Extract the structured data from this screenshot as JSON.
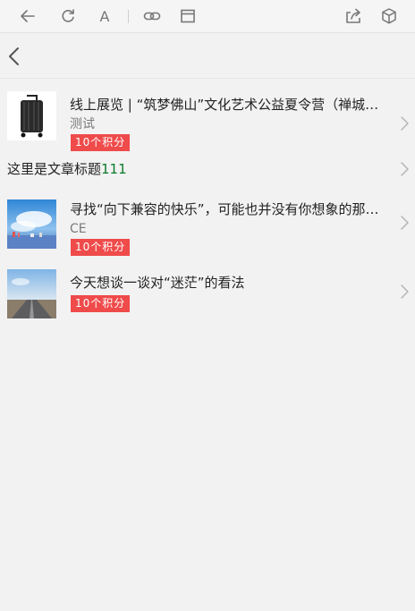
{
  "toolbar": {
    "icons": [
      "back-arrow-icon",
      "refresh-icon",
      "font-icon",
      "link-icon",
      "window-icon",
      "share-icon",
      "cube-icon"
    ],
    "font_glyph": "A"
  },
  "nav": {
    "back_icon": "chevron-left-icon"
  },
  "articles": [
    {
      "title": "线上展览 | “筑梦佛山”文化艺术公益夏令营（禅城区…",
      "subtitle": "测试",
      "badge": "10个积分",
      "thumb": "luggage"
    },
    {
      "title_text": "这里是文章标题",
      "title_num": "111"
    },
    {
      "title": "寻找“向下兼容的快乐”，可能也并没有你想象的那么难",
      "subtitle": "CE",
      "badge": "10个积分",
      "thumb": "sky-city"
    },
    {
      "title": "今天想谈一谈对“迷茫”的看法",
      "badge": "10个积分",
      "thumb": "road"
    }
  ],
  "colors": {
    "badge": "#ef4b4b",
    "background": "#f2f2f2",
    "accent_number": "#0a7a2a"
  }
}
